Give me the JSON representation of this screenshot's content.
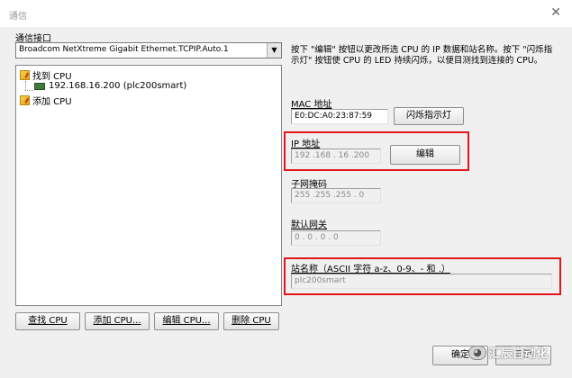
{
  "window": {
    "title": "通信",
    "close_glyph": "✕"
  },
  "interface": {
    "label": "通信接口",
    "selected": "Broadcom NetXtreme Gigabit Ethernet.TCPIP.Auto.1",
    "dropdown_glyph": "▼"
  },
  "tree": {
    "found_label": "找到 CPU",
    "device": "192.168.16.200 (plc200smart)",
    "add_label": "添加 CPU"
  },
  "description": "按下 \"编辑\" 按钮以更改所选 CPU 的 IP 数据和站名称。按下 \"闪烁指示灯\" 按钮使 CPU 的 LED 持续闪烁，以便目测找到连接的 CPU。",
  "mac": {
    "label": "MAC 地址",
    "value": "E0:DC:A0:23:87:59",
    "blink_button": "闪烁指示灯"
  },
  "ip": {
    "label": "IP 地址",
    "value": "192 .168 . 16 .200",
    "edit_button": "编辑"
  },
  "subnet": {
    "label": "子网掩码",
    "value": "255 .255 .255 .  0"
  },
  "gateway": {
    "label": "默认网关",
    "value": "0  .  0  .  0  .  0"
  },
  "station": {
    "label": "站名称（ASCII 字符 a-z、0-9、- 和 .）",
    "value": "plc200smart"
  },
  "bottom_buttons": {
    "find": "查找 CPU",
    "add": "添加 CPU...",
    "edit": "编辑 CPU...",
    "delete": "删除 CPU"
  },
  "dialog_buttons": {
    "ok": "确定",
    "cancel": "取消"
  },
  "watermark": {
    "text": "汇辰自动化",
    "icon": "wechat-icon"
  },
  "colors": {
    "highlight_box": "#e0161a",
    "dialog_bg": "#f0f0f0",
    "plc_icon": "#3f7a3a",
    "found_icon": "#e4a81a"
  }
}
